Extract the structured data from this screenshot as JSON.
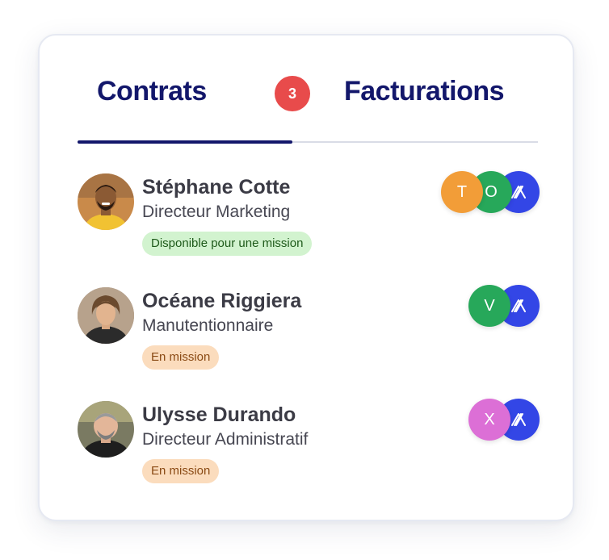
{
  "tabs": {
    "contrats": "Contrats",
    "contrats_count": "3",
    "facturations": "Facturations"
  },
  "people": [
    {
      "name": "Stéphane Cotte",
      "role": "Directeur Marketing",
      "status": "Disponible pour une mission",
      "status_color": "#d2f3cf",
      "chips": [
        {
          "letter": "T",
          "color": "#f29d38"
        },
        {
          "letter": "O",
          "color": "#27a85a"
        },
        {
          "icon": "brand-logo-icon",
          "color": "#3346e6"
        }
      ]
    },
    {
      "name": "Océane Riggiera",
      "role": "Manutentionnaire",
      "status": "En mission",
      "status_color": "#fbdcbd",
      "chips": [
        {
          "letter": "V",
          "color": "#27a85a"
        },
        {
          "icon": "brand-logo-icon",
          "color": "#3346e6"
        }
      ]
    },
    {
      "name": "Ulysse Durando",
      "role": "Directeur Administratif",
      "status": "En mission",
      "status_color": "#fbdcbd",
      "chips": [
        {
          "letter": "X",
          "color": "#dc6fd6"
        },
        {
          "icon": "brand-logo-icon",
          "color": "#3346e6"
        }
      ]
    }
  ],
  "colors": {
    "accent": "#13176b",
    "badge": "#e84b4b"
  }
}
